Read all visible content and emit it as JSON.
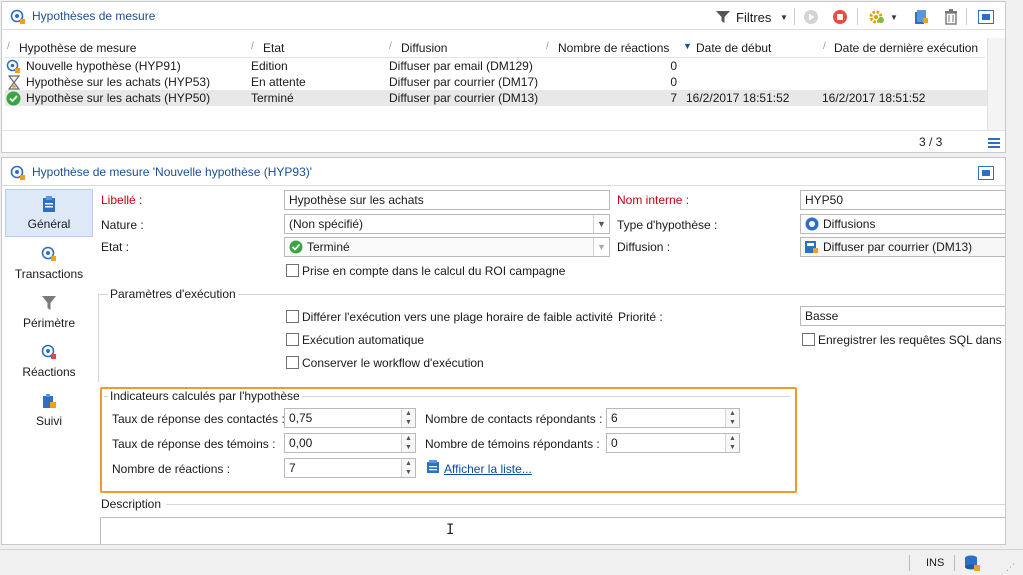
{
  "top_panel": {
    "title": "Hypothèses de mesure",
    "filters_label": "Filtres",
    "pagination": "3 / 3",
    "columns": [
      "Hypothèse de mesure",
      "Etat",
      "Diffusion",
      "Nombre de réactions",
      "Date de début",
      "Date de dernière exécution"
    ],
    "rows": [
      {
        "name": "Nouvelle hypothèse (HYP91)",
        "etat": "Edition",
        "diffusion": "Diffuser par email (DM129)",
        "reactions": "0",
        "debut": "",
        "derniere": "",
        "icon": "hypothesis-new-icon"
      },
      {
        "name": "Hypothèse sur les achats (HYP53)",
        "etat": "En attente",
        "diffusion": "Diffuser par courrier (DM17)",
        "reactions": "0",
        "debut": "",
        "derniere": "",
        "icon": "hourglass-icon"
      },
      {
        "name": "Hypothèse sur les achats (HYP50)",
        "etat": "Terminé",
        "diffusion": "Diffuser par courrier (DM13)",
        "reactions": "7",
        "debut": "16/2/2017 18:51:52",
        "derniere": "16/2/2017 18:51:52",
        "icon": "check-circle-icon"
      }
    ]
  },
  "detail": {
    "title": "Hypothèse de mesure 'Nouvelle hypothèse (HYP93)'",
    "nav": [
      {
        "label": "Général",
        "icon": "clipboard-icon"
      },
      {
        "label": "Transactions",
        "icon": "transactions-icon"
      },
      {
        "label": "Périmètre",
        "icon": "funnel-icon"
      },
      {
        "label": "Réactions",
        "icon": "reactions-icon"
      },
      {
        "label": "Suivi",
        "icon": "tracking-icon"
      }
    ],
    "labels": {
      "libelle": "Libellé :",
      "nature": "Nature :",
      "etat": "Etat :",
      "nom_interne": "Nom interne :",
      "type": "Type d'hypothèse :",
      "diffusion": "Diffusion :",
      "roi": "Prise en compte dans le calcul du ROI campagne",
      "params": "Paramètres d'exécution",
      "differer": "Différer l'exécution vers une plage horaire de faible activité",
      "auto": "Exécution automatique",
      "conserver": "Conserver le workflow d'exécution",
      "priorite": "Priorité :",
      "enregistrer": "Enregistrer les requêtes SQL dans le",
      "indicateurs": "Indicateurs calculés par l'hypothèse",
      "taux_contacts": "Taux de réponse des contactés :",
      "taux_temoins": "Taux de réponse des témoins :",
      "nb_reactions": "Nombre de réactions :",
      "nb_contacts": "Nombre de contacts répondants :",
      "nb_temoins": "Nombre de témoins répondants :",
      "afficher": "Afficher la liste...",
      "description": "Description"
    },
    "values": {
      "libelle": "Hypothèse sur les achats",
      "nature": "(Non spécifié)",
      "etat": "Terminé",
      "nom_interne": "HYP50",
      "type": "Diffusions",
      "diffusion": "Diffuser par courrier (DM13)",
      "priorite": "Basse",
      "taux_contacts": "0,75",
      "taux_temoins": "0,00",
      "nb_reactions": "7",
      "nb_contacts": "6",
      "nb_temoins": "0"
    }
  },
  "status": {
    "mode": "INS"
  },
  "colors": {
    "accent_title": "#1c4f91",
    "highlight_box": "#f09a2a",
    "required_label": "#c8000f"
  }
}
